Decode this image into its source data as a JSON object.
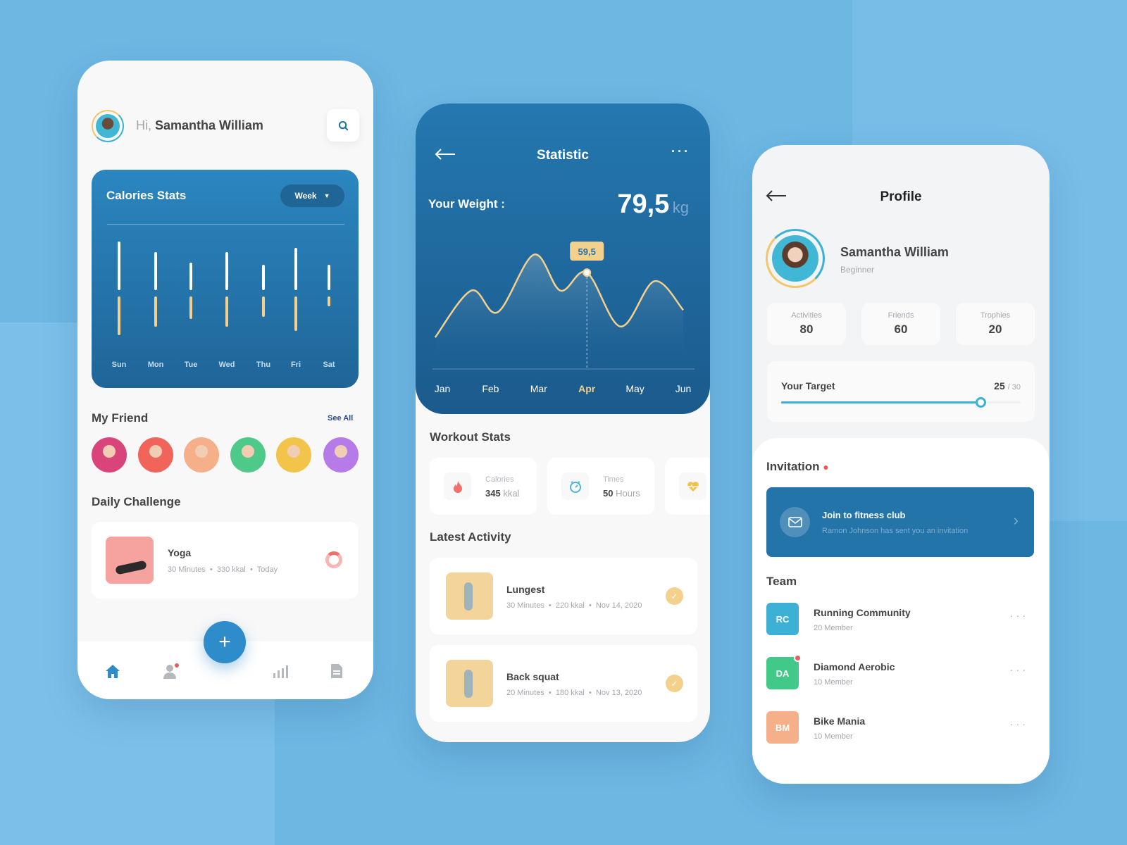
{
  "colors": {
    "background": "#6db7e3",
    "primary": "#2374a8",
    "accent_yellow": "#f3d18d",
    "accent_cyan": "#3db1d5",
    "alert": "#e85c5c"
  },
  "home": {
    "greeting_prefix": "Hi,",
    "user_name": "Samantha William",
    "search_icon": "search-icon",
    "calories": {
      "title": "Calories Stats",
      "period": "Week"
    },
    "friends": {
      "title": "My Friend",
      "see_all": "See All",
      "avatar_colors": [
        "#d9457a",
        "#f0645a",
        "#f5b08a",
        "#4fc98a",
        "#f2c44a",
        "#b67be8"
      ]
    },
    "challenge": {
      "title": "Daily Challenge",
      "name": "Yoga",
      "duration": "30 Minutes",
      "energy": "330 kkal",
      "when": "Today"
    },
    "nav": [
      "home-icon",
      "profile-icon",
      "add-icon",
      "chart-icon",
      "document-icon"
    ]
  },
  "statistic": {
    "title": "Statistic",
    "weight_label": "Your Weight :",
    "weight_value": "79,5",
    "weight_unit": "kg",
    "tooltip": "59,5",
    "selected_month": "Apr",
    "workout_title": "Workout Stats",
    "workout": [
      {
        "label": "Calories",
        "value": "345",
        "unit": "kkal",
        "icon": "flame-icon"
      },
      {
        "label": "Times",
        "value": "50",
        "unit": "Hours",
        "icon": "stopwatch-icon"
      },
      {
        "icon": "heart-rate-icon"
      }
    ],
    "activity_title": "Latest Activity",
    "activities": [
      {
        "name": "Lungest",
        "duration": "30 Minutes",
        "energy": "220 kkal",
        "date": "Nov 14, 2020"
      },
      {
        "name": "Back squat",
        "duration": "20 Minutes",
        "energy": "180 kkal",
        "date": "Nov 13, 2020"
      }
    ]
  },
  "profile": {
    "title": "Profile",
    "name": "Samantha William",
    "level": "Beginner",
    "stats": [
      {
        "label": "Activities",
        "value": "80"
      },
      {
        "label": "Friends",
        "value": "60"
      },
      {
        "label": "Trophies",
        "value": "20"
      }
    ],
    "target": {
      "label": "Your Target",
      "value": "25",
      "max": "/ 30",
      "fraction": 0.833
    },
    "invitation": {
      "title": "Invitation",
      "heading": "Join to fitness club",
      "text": "Ramon Johnson has sent you an invitation"
    },
    "team_title": "Team",
    "teams": [
      {
        "initials": "RC",
        "name": "Running Community",
        "members": "20 Member",
        "color": "#3db1d5",
        "badge": false
      },
      {
        "initials": "DA",
        "name": "Diamond Aerobic",
        "members": "10 Member",
        "color": "#41c98a",
        "badge": true
      },
      {
        "initials": "BM",
        "name": "Bike Mania",
        "members": "10 Member",
        "color": "#f5b08a",
        "badge": false
      }
    ]
  },
  "chart_data": [
    {
      "type": "bar",
      "title": "Calories Stats",
      "categories": [
        "Sun",
        "Mon",
        "Tue",
        "Wed",
        "Thu",
        "Fri",
        "Sat"
      ],
      "series": [
        {
          "values": [
            68,
            53,
            38,
            53,
            35,
            59,
            35
          ],
          "color": "#ffffff"
        },
        {
          "values": [
            54,
            42,
            31,
            42,
            28,
            48,
            14
          ],
          "color": "#f3d18d"
        }
      ]
    },
    {
      "type": "area",
      "categories": [
        "Jan",
        "Feb",
        "Mar",
        "Apr",
        "May",
        "Jun"
      ],
      "x": [
        -0.15,
        0.6,
        1.15,
        1.9,
        2.45,
        3,
        3.7,
        4.4,
        5.0
      ],
      "y": [
        19.5,
        48.4,
        35.1,
        70.6,
        48.4,
        59.5,
        26.2,
        54.2,
        36.4
      ],
      "highlight": {
        "x": 3,
        "y": 59.5,
        "label": "59,5"
      },
      "ylim": [
        0,
        80
      ]
    }
  ]
}
